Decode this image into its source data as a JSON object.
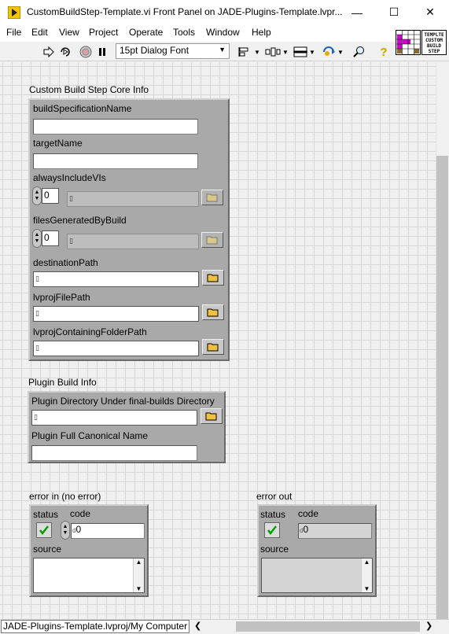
{
  "window": {
    "title": "CustomBuildStep-Template.vi Front Panel on JADE-Plugins-Template.lvpr...",
    "minimize": "—",
    "maximize": "☐",
    "close": "✕"
  },
  "menu": [
    "File",
    "Edit",
    "View",
    "Project",
    "Operate",
    "Tools",
    "Window",
    "Help"
  ],
  "toolbar": {
    "font": "15pt Dialog Font",
    "run_icon": "run-arrow-icon",
    "run_continuous_icon": "run-continuously-icon",
    "abort_icon": "abort-icon",
    "pause_icon": "pause-icon",
    "align_icon": "align-objects-icon",
    "distribute_icon": "distribute-objects-icon",
    "resize_icon": "resize-objects-icon",
    "reorder_icon": "reorder-icon",
    "search_icon": "search-icon",
    "help_icon": "context-help-icon"
  },
  "vi_icon_text": [
    "TEMPLTE",
    "CUSTOM",
    "BUILD",
    "STEP"
  ],
  "core": {
    "label": "Custom Build Step Core Info",
    "buildSpecificationName": {
      "label": "buildSpecificationName",
      "value": ""
    },
    "targetName": {
      "label": "targetName",
      "value": ""
    },
    "alwaysIncludeVIs": {
      "label": "alwaysIncludeVIs",
      "index": "0"
    },
    "filesGeneratedByBuild": {
      "label": "filesGeneratedByBuild",
      "index": "0"
    },
    "destinationPath": {
      "label": "destinationPath",
      "value": ""
    },
    "lvprojFilePath": {
      "label": "lvprojFilePath",
      "value": ""
    },
    "lvprojContainingFolderPath": {
      "label": "lvprojContainingFolderPath",
      "value": ""
    }
  },
  "plugin": {
    "label": "Plugin Build Info",
    "directory": {
      "label": "Plugin Directory Under final-builds Directory",
      "value": ""
    },
    "canonical": {
      "label": "Plugin Full Canonical Name",
      "value": ""
    }
  },
  "error_in": {
    "label": "error in (no error)",
    "status_label": "status",
    "code_label": "code",
    "code_value": "0",
    "source_label": "source"
  },
  "error_out": {
    "label": "error out",
    "status_label": "status",
    "code_label": "code",
    "code_value": "0",
    "source_label": "source"
  },
  "status_bar": {
    "path": "JADE-Plugins-Template.lvproj/My Computer"
  },
  "colors": {
    "cluster_bg": "#a9a9a9",
    "panel_bg": "#f0f0f0",
    "grid": "#d7d7d7"
  }
}
